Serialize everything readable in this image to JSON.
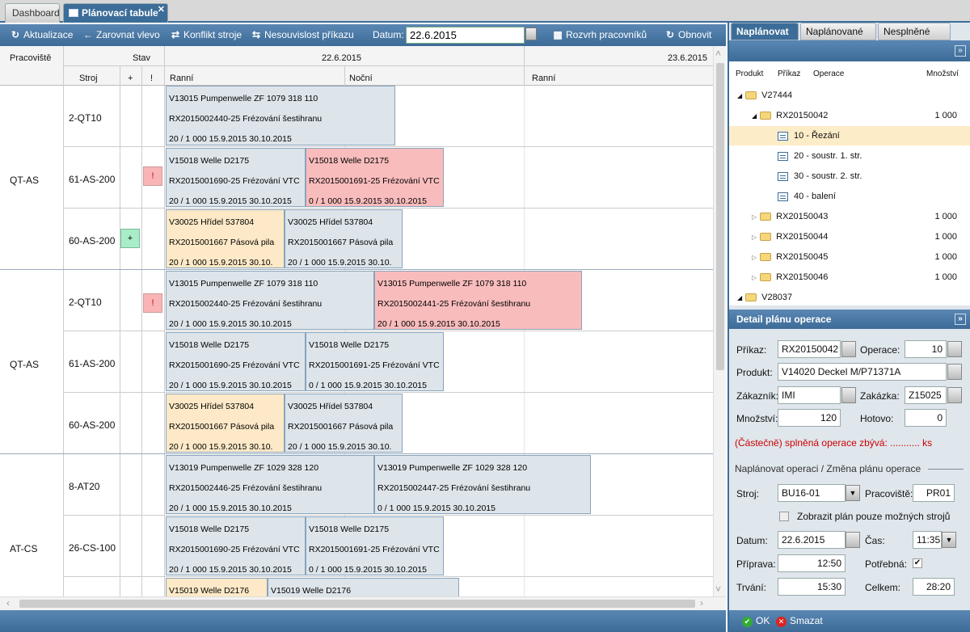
{
  "tabs": {
    "dashboard": "Dashboard",
    "planning": "Plánovací tabule"
  },
  "toolbar": {
    "refresh": "Aktualizace",
    "align_left": "Zarovnat vlevo",
    "machine_conflict": "Konflikt stroje",
    "order_inconsistency": "Nesouvislost příkazu",
    "date_label": "Datum:",
    "date_value": "22.6.2015",
    "staff_schedule": "Rozvrh pracovníků",
    "reload": "Obnovit"
  },
  "grid": {
    "headers": {
      "workplace": "Pracoviště",
      "status": "Stav",
      "machine": "Stroj",
      "plus": "+",
      "excl": "!",
      "date1": "22.6.2015",
      "date2": "23.6.2015",
      "shift_morning": "Ranní",
      "shift_night": "Noční",
      "shift_morning2": "Ranní"
    },
    "workplaces": [
      "QT-AS",
      "QT-AS",
      "AT-CS"
    ],
    "machines": [
      "2-QT10",
      "61-AS-200",
      "60-AS-200",
      "2-QT10",
      "61-AS-200",
      "60-AS-200",
      "8-AT20",
      "26-CS-100"
    ],
    "flags": {
      "excl": "!",
      "plus": "+"
    },
    "cards": [
      {
        "l1": "V13015 Pumpenwelle ZF 1079 318 110",
        "l2": "RX2015002440-25 Frézování šestihranu",
        "l3": "20 / 1 000        15.9.2015        30.10.2015"
      },
      {
        "l1": "V15018 Welle D2175",
        "l2": "RX2015001690-25 Frézování VTC",
        "l3": "20 / 1 000  15.9.2015  30.10.2015"
      },
      {
        "l1": "V15018 Welle D2175",
        "l2": "RX2015001691-25 Frézování VTC",
        "l3": "0 / 1 000  15.9.2015  30.10.2015"
      },
      {
        "l1": "V30025 Hřídel 537804",
        "l2": "RX2015001667 Pásová pila",
        "l3": "20 / 1 000  15.9.2015  30.10."
      },
      {
        "l1": "V30025 Hřídel 537804",
        "l2": "RX2015001667 Pásová pila",
        "l3": "20 / 1 000  15.9.2015  30.10."
      },
      {
        "l1": "V13015 Pumpenwelle ZF 1079 318 110",
        "l2": "RX2015002440-25 Frézování šestihranu",
        "l3": "20 / 1 000        15.9.2015        30.10.2015"
      },
      {
        "l1": "V13015 Pumpenwelle ZF 1079 318 110",
        "l2": "RX2015002441-25 Frézování šestihranu",
        "l3": "20 / 1 000        15.9.2015        30.10.2015"
      },
      {
        "l1": "V15018 Welle D2175",
        "l2": "RX2015001690-25 Frézování VTC",
        "l3": "20 / 1 000  15.9.2015  30.10.2015"
      },
      {
        "l1": "V15018 Welle D2175",
        "l2": "RX2015001691-25 Frézování VTC",
        "l3": "0 / 1 000  15.9.2015  30.10.2015"
      },
      {
        "l1": "V30025 Hřídel 537804",
        "l2": "RX2015001667 Pásová pila",
        "l3": "20 / 1 000  15.9.2015  30.10."
      },
      {
        "l1": "V30025 Hřídel 537804",
        "l2": "RX2015001667 Pásová pila",
        "l3": "20 / 1 000  15.9.2015  30.10."
      },
      {
        "l1": "V13019 Pumpenwelle ZF 1029 328 120",
        "l2": "RX2015002446-25 Frézování šestihranu",
        "l3": "20 / 1 000        15.9.2015        30.10.2015"
      },
      {
        "l1": "V13019 Pumpenwelle ZF 1029 328 120",
        "l2": "RX2015002447-25 Frézování šestihranu",
        "l3": "0 / 1 000        15.9.2015        30.10.2015"
      },
      {
        "l1": "V15018 Welle D2175",
        "l2": "RX2015001690-25 Frézování VTC",
        "l3": "20 / 1 000  15.9.2015  30.10.2015"
      },
      {
        "l1": "V15018 Welle D2175",
        "l2": "RX2015001691-25 Frézování VTC",
        "l3": "0 / 1 000  15.9.2015  30.10.2015"
      },
      {
        "l1": "V15019 Welle D2176",
        "l2": "",
        "l3": ""
      },
      {
        "l1": "V15019 Welle D2176",
        "l2": "",
        "l3": ""
      }
    ]
  },
  "right": {
    "tabs": [
      "Naplánovat",
      "Naplánované",
      "Nesplněné"
    ],
    "tree_headers": {
      "product": "Produkt",
      "order": "Příkaz",
      "operation": "Operace",
      "qty": "Množství"
    },
    "tree": [
      {
        "label": "V27444",
        "qty": "",
        "toggle": "◢"
      },
      {
        "label": "RX20150042",
        "qty": "1 000",
        "toggle": "◢"
      },
      {
        "label": "10 - Řezání",
        "qty": ""
      },
      {
        "label": "20 - soustr. 1. str.",
        "qty": ""
      },
      {
        "label": "30 - soustr. 2. str.",
        "qty": ""
      },
      {
        "label": "40 - balení",
        "qty": ""
      },
      {
        "label": "RX20150043",
        "qty": "1 000",
        "toggle": "▷"
      },
      {
        "label": "RX20150044",
        "qty": "1 000",
        "toggle": "▷"
      },
      {
        "label": "RX20150045",
        "qty": "1 000",
        "toggle": "▷"
      },
      {
        "label": "RX20150046",
        "qty": "1 000",
        "toggle": "▷"
      },
      {
        "label": "V28037",
        "qty": "",
        "toggle": "◢"
      }
    ]
  },
  "detail": {
    "title": "Detail plánu operace",
    "order_label": "Příkaz:",
    "order_value": "RX20150042",
    "operation_label": "Operace:",
    "operation_value": "10",
    "product_label": "Produkt:",
    "product_value": "V14020  Deckel M/P71371A",
    "customer_label": "Zákazník:",
    "customer_value": "IMI",
    "contract_label": "Zakázka:",
    "contract_value": "Z15025",
    "qty_label": "Množství:",
    "qty_value": "120",
    "done_label": "Hotovo:",
    "done_value": "0",
    "warning": "(Částečně) splněná operace zbývá: ........... ks",
    "section": "Naplánovat operaci / Změna plánu operace",
    "machine_label": "Stroj:",
    "machine_value": "BU16-01",
    "workplace_label": "Pracoviště:",
    "workplace_value": "PR01",
    "only_possible": "Zobrazit plán pouze možných strojů",
    "date_label": "Datum:",
    "date_value": "22.6.2015",
    "time_label": "Čas:",
    "time_value": "11:35",
    "prep_label": "Příprava:",
    "prep_value": "12:50",
    "required_label": "Potřebná:",
    "required_check": "✔",
    "duration_label": "Trvání:",
    "duration_value": "15:30",
    "total_label": "Celkem:",
    "total_value": "28:20",
    "ok": "OK",
    "delete": "Smazat"
  }
}
